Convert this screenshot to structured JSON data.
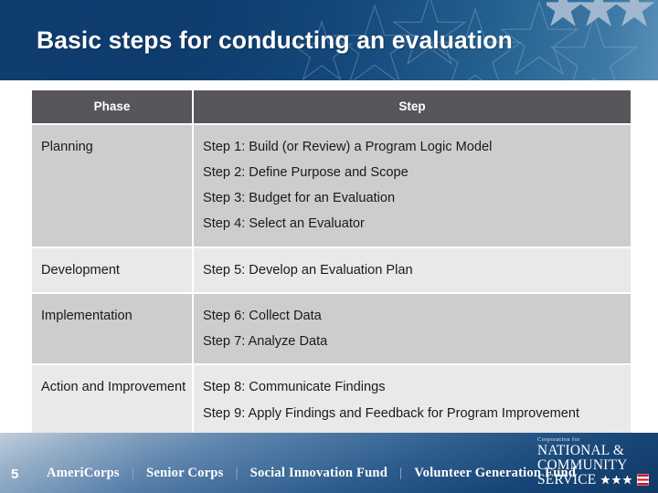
{
  "slide": {
    "title": "Basic steps for conducting an evaluation",
    "number": "5",
    "accent_blue": "#0e3d6e",
    "header_band_end": "#5a90b8",
    "table_header_bg": "#58565a",
    "row_shade_dark": "#cdcdcd",
    "row_shade_light": "#e9e9e9"
  },
  "decor": {
    "header_outline_stars": "star-outline-icon",
    "header_solid_stars": "star-solid-icon",
    "logo_stars": "star-solid-icon",
    "logo_flag": "flag-stripes-icon"
  },
  "table": {
    "columns": [
      {
        "key": "phase",
        "label": "Phase"
      },
      {
        "key": "step",
        "label": "Step"
      }
    ],
    "rows": [
      {
        "phase": "Planning",
        "steps": [
          "Step 1: Build (or Review) a Program Logic Model",
          "Step 2: Define Purpose and Scope",
          "Step 3: Budget for an Evaluation",
          "Step 4: Select an Evaluator"
        ]
      },
      {
        "phase": "Development",
        "steps": [
          "Step 5: Develop an Evaluation Plan"
        ]
      },
      {
        "phase": "Implementation",
        "steps": [
          "Step 6: Collect Data",
          "Step 7: Analyze Data"
        ]
      },
      {
        "phase": "Action and Improvement",
        "steps": [
          "Step 8: Communicate Findings",
          "Step 9: Apply Findings and Feedback for Program Improvement"
        ]
      }
    ]
  },
  "footer": {
    "programs": [
      "AmeriCorps",
      "Senior Corps",
      "Social Innovation Fund",
      "Volunteer Generation Fund"
    ],
    "separator": "|",
    "logo": {
      "corporation_for": "Corporation for",
      "line1": "NATIONAL &",
      "line2": "COMMUNITY",
      "line3": "SERVICE"
    }
  }
}
